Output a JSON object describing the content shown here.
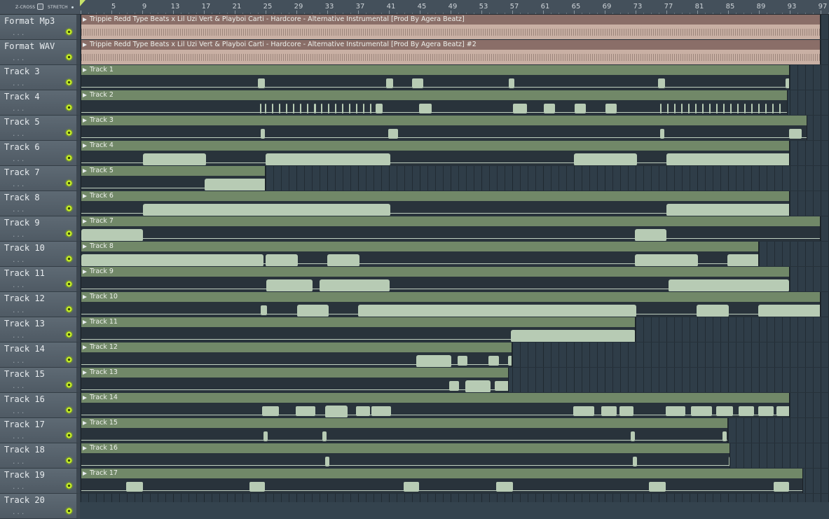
{
  "toolbar": {
    "zcross_label": "Z-CROSS",
    "stretch_label": "STRETCH"
  },
  "ruler": {
    "bars": [
      "5",
      "9",
      "13",
      "17",
      "21",
      "25",
      "29",
      "33",
      "37",
      "41",
      "45",
      "49",
      "53",
      "57",
      "61",
      "65",
      "69",
      "73",
      "77",
      "81",
      "85",
      "89",
      "93",
      "97"
    ]
  },
  "headers": {
    "dots": "...",
    "tracks": [
      "Format Mp3",
      "Format WAV",
      "Track 3",
      "Track 4",
      "Track 5",
      "Track 6",
      "Track 7",
      "Track 8",
      "Track 9",
      "Track 10",
      "Track 11",
      "Track 12",
      "Track 13",
      "Track 14",
      "Track 15",
      "Track 16",
      "Track 17",
      "Track 18",
      "Track 19",
      "Track 20"
    ]
  },
  "clips": [
    {
      "lane": 0,
      "title": "Trippie Redd Type Beats x Lil Uzi Vert & Playboi Carti - Hardcore - Alternative Instrumental [Prod By Agera Beatz]",
      "type": "audio",
      "bars": [
        1,
        97.0
      ]
    },
    {
      "lane": 1,
      "title": "Trippie Redd Type Beats x Lil Uzi Vert & Playboi Carti - Hardcore - Alternative Instrumental [Prod By Agera Beatz] #2",
      "type": "audio",
      "bars": [
        1,
        97.0
      ]
    },
    {
      "lane": 2,
      "title": "Track 1",
      "bars": [
        1,
        93.0
      ]
    },
    {
      "lane": 3,
      "title": "Track 2",
      "bars": [
        1,
        92.75
      ]
    },
    {
      "lane": 4,
      "title": "Track 3",
      "bars": [
        1,
        95.25
      ]
    },
    {
      "lane": 5,
      "title": "Track 4",
      "bars": [
        1,
        93.0
      ]
    },
    {
      "lane": 6,
      "title": "Track 5",
      "bars": [
        1,
        25.0
      ]
    },
    {
      "lane": 7,
      "title": "Track 6",
      "bars": [
        1,
        93.0
      ]
    },
    {
      "lane": 8,
      "title": "Track 7",
      "bars": [
        1,
        97.0
      ]
    },
    {
      "lane": 9,
      "title": "Track 8",
      "bars": [
        1,
        89.0
      ]
    },
    {
      "lane": 10,
      "title": "Track 9",
      "bars": [
        1,
        93.0
      ]
    },
    {
      "lane": 11,
      "title": "Track 10",
      "bars": [
        1,
        97.0
      ]
    },
    {
      "lane": 12,
      "title": "Track 11",
      "bars": [
        1,
        73.0
      ]
    },
    {
      "lane": 13,
      "title": "Track 12",
      "bars": [
        1,
        57.0
      ]
    },
    {
      "lane": 14,
      "title": "Track 13",
      "bars": [
        1,
        56.5
      ]
    },
    {
      "lane": 15,
      "title": "Track 14",
      "bars": [
        1,
        93.0
      ]
    },
    {
      "lane": 16,
      "title": "Track 15",
      "bars": [
        1,
        85.0
      ]
    },
    {
      "lane": 17,
      "title": "Track 16",
      "bars": [
        1,
        85.25
      ]
    },
    {
      "lane": 18,
      "title": "Track 17",
      "bars": [
        1,
        94.75
      ]
    }
  ]
}
